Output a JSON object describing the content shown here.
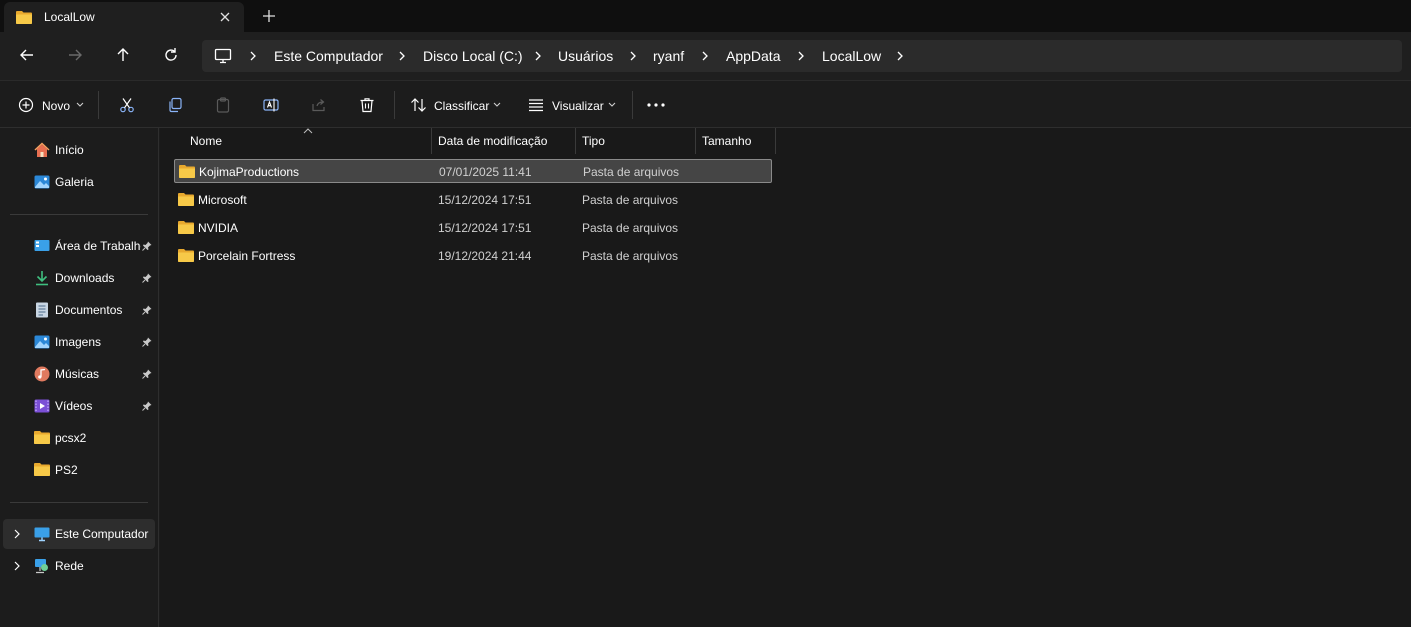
{
  "tab": {
    "title": "LocalLow",
    "icon": "folder-icon"
  },
  "breadcrumb": [
    "Este Computador",
    "Disco Local (C:)",
    "Usuários",
    "ryanf",
    "AppData",
    "LocalLow"
  ],
  "toolbar": {
    "new_label": "Novo",
    "sort_label": "Classificar",
    "view_label": "Visualizar"
  },
  "sidebar": {
    "top": [
      {
        "label": "Início",
        "icon": "home-icon"
      },
      {
        "label": "Galeria",
        "icon": "gallery-icon"
      }
    ],
    "quick": [
      {
        "label": "Área de Trabalho",
        "icon": "desktop-icon",
        "pinned": true
      },
      {
        "label": "Downloads",
        "icon": "download-icon",
        "pinned": true
      },
      {
        "label": "Documentos",
        "icon": "document-icon",
        "pinned": true
      },
      {
        "label": "Imagens",
        "icon": "pictures-icon",
        "pinned": true
      },
      {
        "label": "Músicas",
        "icon": "music-icon",
        "pinned": true
      },
      {
        "label": "Vídeos",
        "icon": "video-icon",
        "pinned": true
      },
      {
        "label": "pcsx2",
        "icon": "folder-icon",
        "pinned": false
      },
      {
        "label": "PS2",
        "icon": "folder-icon",
        "pinned": false
      }
    ],
    "bottom": [
      {
        "label": "Este Computador",
        "icon": "computer-icon",
        "selected": true
      },
      {
        "label": "Rede",
        "icon": "network-icon",
        "selected": false
      }
    ]
  },
  "columns": {
    "name": "Nome",
    "date": "Data de modificação",
    "type": "Tipo",
    "size": "Tamanho"
  },
  "files": [
    {
      "name": "KojimaProductions",
      "date": "07/01/2025 11:41",
      "type": "Pasta de arquivos",
      "selected": true
    },
    {
      "name": "Microsoft",
      "date": "15/12/2024 17:51",
      "type": "Pasta de arquivos",
      "selected": false
    },
    {
      "name": "NVIDIA",
      "date": "15/12/2024 17:51",
      "type": "Pasta de arquivos",
      "selected": false
    },
    {
      "name": "Porcelain Fortress",
      "date": "19/12/2024 21:44",
      "type": "Pasta de arquivos",
      "selected": false
    }
  ],
  "colors": {
    "folder": "#f7c948",
    "accent": "#4cc2ff"
  }
}
